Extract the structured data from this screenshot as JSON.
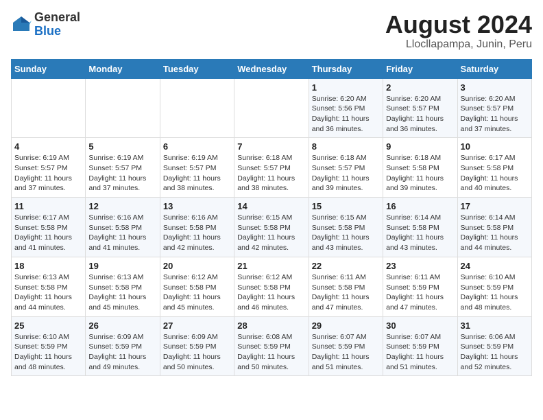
{
  "logo": {
    "text_general": "General",
    "text_blue": "Blue"
  },
  "title": "August 2024",
  "subtitle": "Llocllapampa, Junin, Peru",
  "weekdays": [
    "Sunday",
    "Monday",
    "Tuesday",
    "Wednesday",
    "Thursday",
    "Friday",
    "Saturday"
  ],
  "weeks": [
    [
      {
        "day": "",
        "info": ""
      },
      {
        "day": "",
        "info": ""
      },
      {
        "day": "",
        "info": ""
      },
      {
        "day": "",
        "info": ""
      },
      {
        "day": "1",
        "info": "Sunrise: 6:20 AM\nSunset: 5:56 PM\nDaylight: 11 hours and 36 minutes."
      },
      {
        "day": "2",
        "info": "Sunrise: 6:20 AM\nSunset: 5:57 PM\nDaylight: 11 hours and 36 minutes."
      },
      {
        "day": "3",
        "info": "Sunrise: 6:20 AM\nSunset: 5:57 PM\nDaylight: 11 hours and 37 minutes."
      }
    ],
    [
      {
        "day": "4",
        "info": "Sunrise: 6:19 AM\nSunset: 5:57 PM\nDaylight: 11 hours and 37 minutes."
      },
      {
        "day": "5",
        "info": "Sunrise: 6:19 AM\nSunset: 5:57 PM\nDaylight: 11 hours and 37 minutes."
      },
      {
        "day": "6",
        "info": "Sunrise: 6:19 AM\nSunset: 5:57 PM\nDaylight: 11 hours and 38 minutes."
      },
      {
        "day": "7",
        "info": "Sunrise: 6:18 AM\nSunset: 5:57 PM\nDaylight: 11 hours and 38 minutes."
      },
      {
        "day": "8",
        "info": "Sunrise: 6:18 AM\nSunset: 5:57 PM\nDaylight: 11 hours and 39 minutes."
      },
      {
        "day": "9",
        "info": "Sunrise: 6:18 AM\nSunset: 5:58 PM\nDaylight: 11 hours and 39 minutes."
      },
      {
        "day": "10",
        "info": "Sunrise: 6:17 AM\nSunset: 5:58 PM\nDaylight: 11 hours and 40 minutes."
      }
    ],
    [
      {
        "day": "11",
        "info": "Sunrise: 6:17 AM\nSunset: 5:58 PM\nDaylight: 11 hours and 41 minutes."
      },
      {
        "day": "12",
        "info": "Sunrise: 6:16 AM\nSunset: 5:58 PM\nDaylight: 11 hours and 41 minutes."
      },
      {
        "day": "13",
        "info": "Sunrise: 6:16 AM\nSunset: 5:58 PM\nDaylight: 11 hours and 42 minutes."
      },
      {
        "day": "14",
        "info": "Sunrise: 6:15 AM\nSunset: 5:58 PM\nDaylight: 11 hours and 42 minutes."
      },
      {
        "day": "15",
        "info": "Sunrise: 6:15 AM\nSunset: 5:58 PM\nDaylight: 11 hours and 43 minutes."
      },
      {
        "day": "16",
        "info": "Sunrise: 6:14 AM\nSunset: 5:58 PM\nDaylight: 11 hours and 43 minutes."
      },
      {
        "day": "17",
        "info": "Sunrise: 6:14 AM\nSunset: 5:58 PM\nDaylight: 11 hours and 44 minutes."
      }
    ],
    [
      {
        "day": "18",
        "info": "Sunrise: 6:13 AM\nSunset: 5:58 PM\nDaylight: 11 hours and 44 minutes."
      },
      {
        "day": "19",
        "info": "Sunrise: 6:13 AM\nSunset: 5:58 PM\nDaylight: 11 hours and 45 minutes."
      },
      {
        "day": "20",
        "info": "Sunrise: 6:12 AM\nSunset: 5:58 PM\nDaylight: 11 hours and 45 minutes."
      },
      {
        "day": "21",
        "info": "Sunrise: 6:12 AM\nSunset: 5:58 PM\nDaylight: 11 hours and 46 minutes."
      },
      {
        "day": "22",
        "info": "Sunrise: 6:11 AM\nSunset: 5:58 PM\nDaylight: 11 hours and 47 minutes."
      },
      {
        "day": "23",
        "info": "Sunrise: 6:11 AM\nSunset: 5:59 PM\nDaylight: 11 hours and 47 minutes."
      },
      {
        "day": "24",
        "info": "Sunrise: 6:10 AM\nSunset: 5:59 PM\nDaylight: 11 hours and 48 minutes."
      }
    ],
    [
      {
        "day": "25",
        "info": "Sunrise: 6:10 AM\nSunset: 5:59 PM\nDaylight: 11 hours and 48 minutes."
      },
      {
        "day": "26",
        "info": "Sunrise: 6:09 AM\nSunset: 5:59 PM\nDaylight: 11 hours and 49 minutes."
      },
      {
        "day": "27",
        "info": "Sunrise: 6:09 AM\nSunset: 5:59 PM\nDaylight: 11 hours and 50 minutes."
      },
      {
        "day": "28",
        "info": "Sunrise: 6:08 AM\nSunset: 5:59 PM\nDaylight: 11 hours and 50 minutes."
      },
      {
        "day": "29",
        "info": "Sunrise: 6:07 AM\nSunset: 5:59 PM\nDaylight: 11 hours and 51 minutes."
      },
      {
        "day": "30",
        "info": "Sunrise: 6:07 AM\nSunset: 5:59 PM\nDaylight: 11 hours and 51 minutes."
      },
      {
        "day": "31",
        "info": "Sunrise: 6:06 AM\nSunset: 5:59 PM\nDaylight: 11 hours and 52 minutes."
      }
    ]
  ]
}
